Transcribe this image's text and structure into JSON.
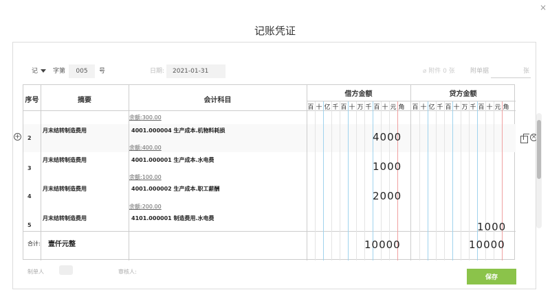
{
  "dialog": {
    "title": "记账凭证",
    "close_label": "×"
  },
  "header": {
    "word": "记",
    "word_label": "字第",
    "number": "005",
    "number_suffix": "号",
    "date_label": "日期:",
    "date": "2021-01-31",
    "attachment": "附件 0 张",
    "voucher_label": "附单据",
    "voucher_value": "",
    "sheet_unit": "张"
  },
  "table": {
    "headers": {
      "seq": "序号",
      "summary": "摘要",
      "account": "会计科目",
      "debit": "借方金额",
      "credit": "贷方金额"
    },
    "units": [
      "百",
      "十",
      "亿",
      "千",
      "百",
      "十",
      "万",
      "千",
      "百",
      "十",
      "元",
      "角"
    ],
    "rows": [
      {
        "seq": "",
        "summary": "",
        "account": "",
        "balance_label": "余额:",
        "balance": "300.00",
        "debit": "",
        "credit": ""
      },
      {
        "seq": "2",
        "summary": "月末结转制造费用",
        "account": "4001.000004 生产成本.机物料耗损",
        "balance_label": "余额:",
        "balance": "400.00",
        "debit": "4000",
        "credit": ""
      },
      {
        "seq": "3",
        "summary": "月末结转制造费用",
        "account": "4001.000001 生产成本.水电费",
        "balance_label": "余额:",
        "balance": "100.00",
        "debit": "1000",
        "credit": ""
      },
      {
        "seq": "4",
        "summary": "月末结转制造费用",
        "account": "4001.000002 生产成本.职工薪酬",
        "balance_label": "余额:",
        "balance": "200.00",
        "debit": "2000",
        "credit": ""
      },
      {
        "seq": "5",
        "summary": "月末结转制造费用",
        "account": "4101.000001 制造费用.水电费",
        "balance_label": "",
        "balance": "",
        "debit": "",
        "credit": "1000"
      }
    ],
    "total": {
      "label": "合计:",
      "amount_words": "壹仟元整",
      "debit": "10000",
      "credit": "10000"
    }
  },
  "footer": {
    "maker_label": "制单人",
    "reviewer_label": "审核人:",
    "save_label": "保存"
  },
  "icons": {
    "add_row": "plus-circle-icon",
    "copy_row": "copy-icon",
    "delete_row": "x-circle-icon"
  },
  "colors": {
    "save_button": "#8bc34a",
    "unit_blue": "#9fd3ee",
    "unit_red": "#f0a0a0"
  }
}
